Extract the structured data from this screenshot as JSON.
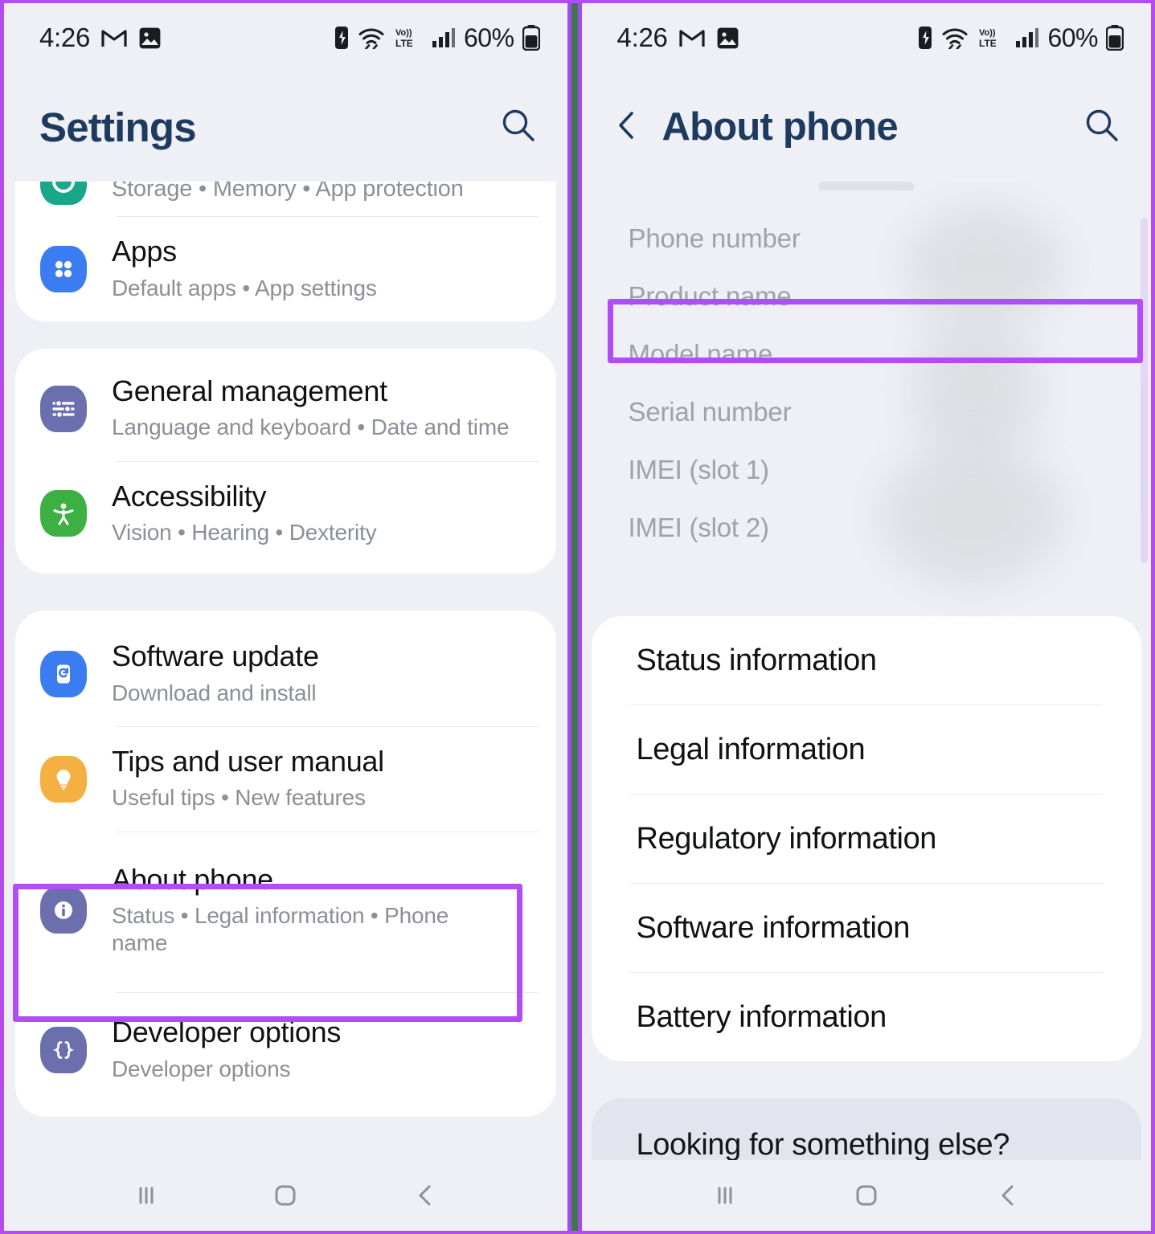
{
  "colors": {
    "highlight": "#b34cf5",
    "divider_strip": "#42774d",
    "panel_bg": "#eef0f5",
    "card_bg": "#ffffff",
    "title_blue": "#1e3a5f",
    "subtitle_grey": "#8b8f96"
  },
  "status_bar": {
    "time": "4:26",
    "left_icons": [
      "gmail-icon",
      "photos-icon"
    ],
    "right_icons": [
      "nfc-icon",
      "wifi-icon",
      "volte-icon",
      "signal-icon"
    ],
    "battery_percent": "60%",
    "battery_icon": "battery-icon"
  },
  "left_panel": {
    "header": {
      "title": "Settings",
      "search_icon": "search-icon"
    },
    "groups": [
      {
        "items": [
          {
            "title": "",
            "subtitle": "Storage  •  Memory  •  App protection",
            "icon": "device-care-icon",
            "icon_color": "#18a78a",
            "partial": true
          },
          {
            "title": "Apps",
            "subtitle": "Default apps  •  App settings",
            "icon": "apps-icon",
            "icon_color": "#3b7df0"
          }
        ]
      },
      {
        "items": [
          {
            "title": "General management",
            "subtitle": "Language and keyboard  •  Date and time",
            "icon": "sliders-icon",
            "icon_color": "#6b6fad"
          },
          {
            "title": "Accessibility",
            "subtitle": "Vision  •  Hearing  •  Dexterity",
            "icon": "accessibility-icon",
            "icon_color": "#3cb043"
          }
        ]
      },
      {
        "items": [
          {
            "title": "Software update",
            "subtitle": "Download and install",
            "icon": "software-update-icon",
            "icon_color": "#3b7df0"
          },
          {
            "title": "Tips and user manual",
            "subtitle": "Useful tips  •  New features",
            "icon": "lightbulb-icon",
            "icon_color": "#f5b042"
          },
          {
            "title": "About phone",
            "subtitle": "Status  •  Legal information  •  Phone name",
            "icon": "info-icon",
            "icon_color": "#6b6fad",
            "highlighted": true
          },
          {
            "title": "Developer options",
            "subtitle": "Developer options",
            "icon": "braces-icon",
            "icon_color": "#6b6fad"
          }
        ]
      }
    ]
  },
  "right_panel": {
    "header": {
      "back_icon": "back-chevron-icon",
      "title": "About phone",
      "search_icon": "search-icon"
    },
    "device_info": [
      {
        "label": "Phone number",
        "value_redacted": true
      },
      {
        "label": "Product name",
        "value_redacted": true
      },
      {
        "label": "Model name",
        "value_redacted": true,
        "highlighted": true
      },
      {
        "label": "Serial number",
        "value_redacted": true
      },
      {
        "label": "IMEI (slot 1)",
        "value_redacted": true
      },
      {
        "label": "IMEI (slot 2)",
        "value_redacted": true
      }
    ],
    "info_links": [
      "Status information",
      "Legal information",
      "Regulatory information",
      "Software information",
      "Battery information"
    ],
    "looking_for": "Looking for something else?"
  },
  "nav_bar": {
    "recents_icon": "recents-icon",
    "home_icon": "home-icon",
    "back_icon": "back-icon"
  }
}
